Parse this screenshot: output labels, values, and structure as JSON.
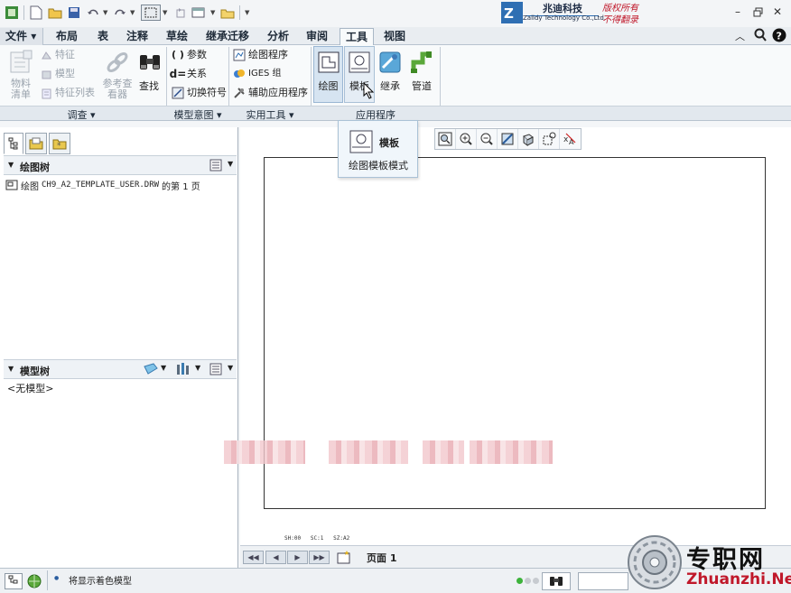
{
  "brand": {
    "name_cn": "兆迪科技",
    "name_en": "Zalldy Technology Co.,Ltd.",
    "copyright_line1": "版权所有",
    "copyright_line2": "不得翻录"
  },
  "tabs": [
    {
      "label": "文件",
      "active": false
    },
    {
      "label": "布局",
      "active": false
    },
    {
      "label": "表",
      "active": false
    },
    {
      "label": "注释",
      "active": false
    },
    {
      "label": "草绘",
      "active": false
    },
    {
      "label": "继承迁移",
      "active": false
    },
    {
      "label": "分析",
      "active": false
    },
    {
      "label": "审阅",
      "active": false
    },
    {
      "label": "工具",
      "active": true
    },
    {
      "label": "视图",
      "active": false
    }
  ],
  "ribbon": {
    "investigate": {
      "bom": "物料\n清单",
      "feature": "特征",
      "model": "模型",
      "feature_list": "特征列表",
      "reference_viewer": "参考查\n看器",
      "find": "查找",
      "group_label": "调查"
    },
    "model_intent": {
      "parameters": "参数",
      "relations": "关系",
      "switch_symbols": "切换符号",
      "group_label": "模型意图"
    },
    "utilities": {
      "drawing_program": "绘图程序",
      "iges_group": "IGES 组",
      "aux_apps": "辅助应用程序",
      "group_label": "实用工具"
    },
    "applications": {
      "drawing": "绘图",
      "template": "模板",
      "inheritance": "继承",
      "piping": "管道",
      "group_label": "应用程序"
    }
  },
  "tooltip": {
    "title": "模板",
    "description": "绘图模板模式"
  },
  "drawing_tree": {
    "title": "绘图树",
    "item_prefix": "绘图",
    "item_name": "CH9_A2_TEMPLATE_USER.DRW",
    "item_suffix": "的第 1 页"
  },
  "model_tree": {
    "title": "模型树",
    "empty_text": "<无模型>"
  },
  "sheet_info": {
    "scale_line": "SH:00   SC:1   SZ:A2"
  },
  "page_nav": {
    "page_label": "页面 1"
  },
  "status_bar": {
    "message": "将显示着色模型"
  },
  "watermark": {
    "cn": "专职网",
    "url": "Zhuanzhi.Net"
  },
  "colors": {
    "brand_red": "#c0182a",
    "accent_blue": "#2f6fb3",
    "ribbon_bg": "#f8fafb"
  }
}
